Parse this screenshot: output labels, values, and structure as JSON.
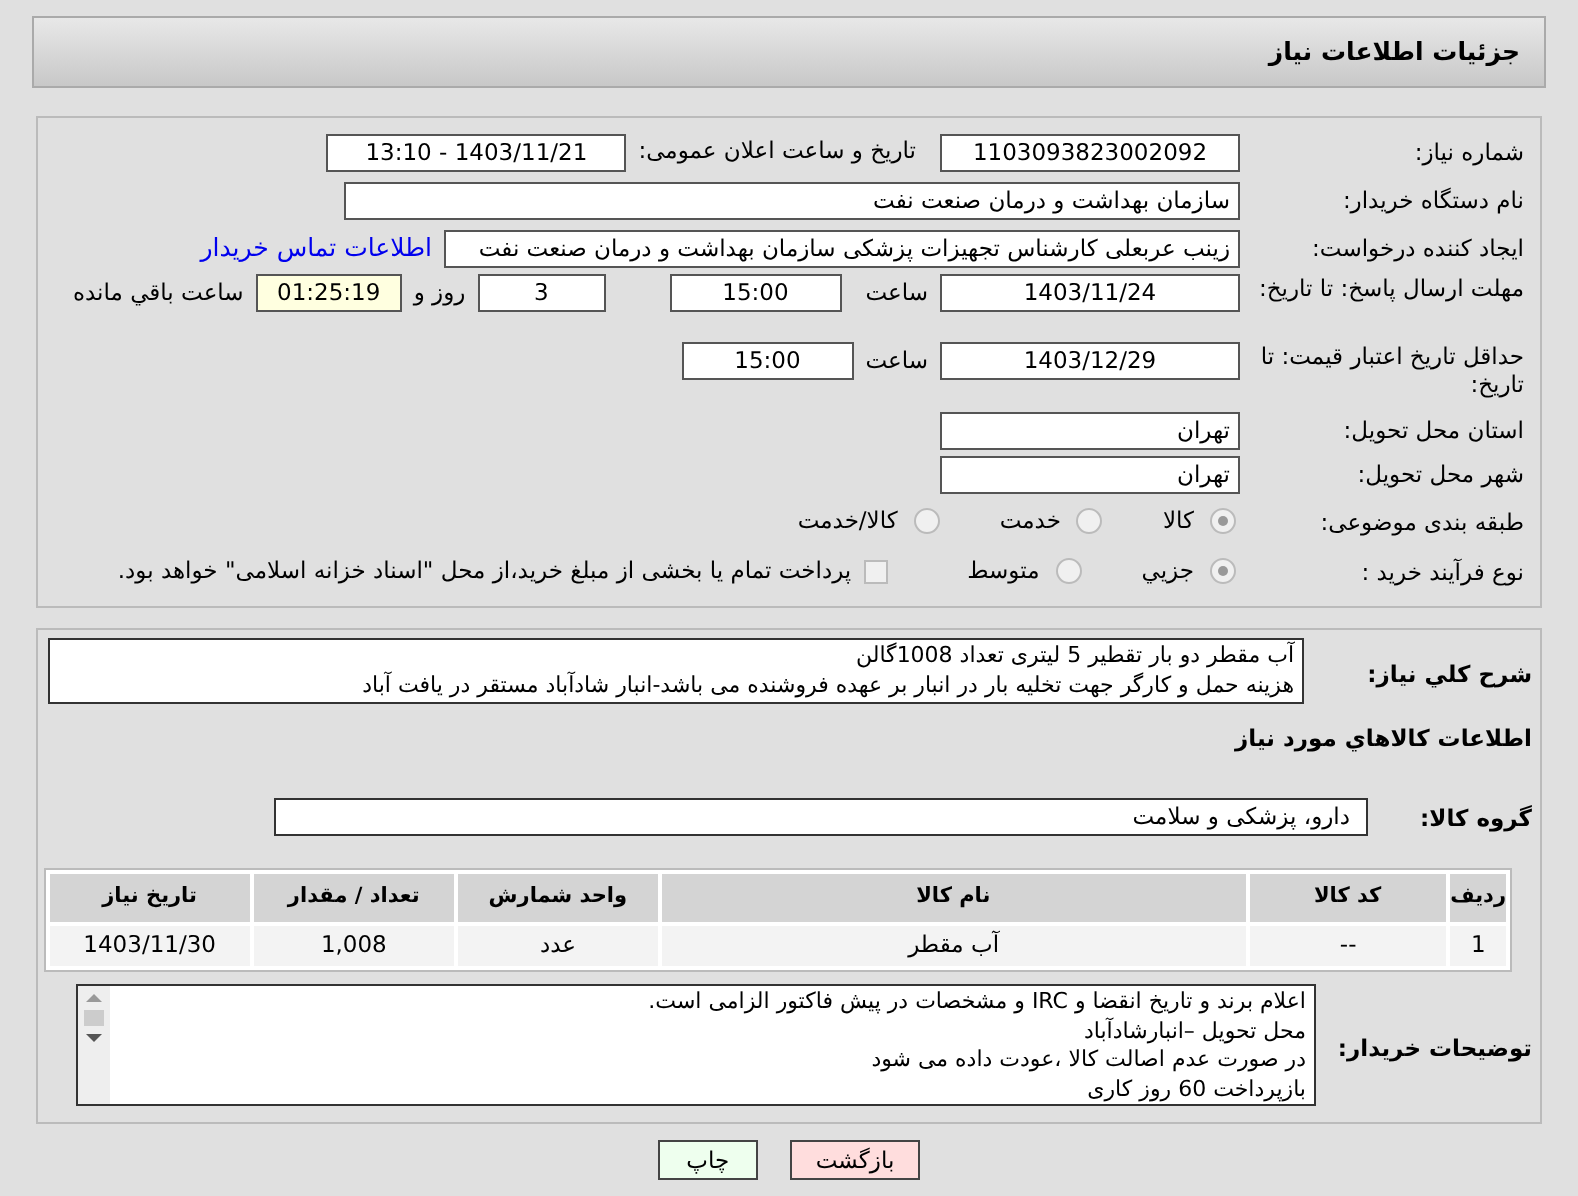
{
  "header": {
    "title": "جزئیات اطلاعات نیاز"
  },
  "need_number": {
    "label": "شماره نیاز:",
    "value": "1103093823002092"
  },
  "announce": {
    "label": "تاریخ و ساعت اعلان عمومی:",
    "value": "1403/11/21 - 13:10"
  },
  "buyer_org": {
    "label": "نام دستگاه خریدار:",
    "value": "سازمان بهداشت و درمان صنعت نفت"
  },
  "requester": {
    "label": "ایجاد کننده درخواست:",
    "value": "زینب عربعلی کارشناس تجهیزات پزشکی سازمان بهداشت و درمان صنعت نفت",
    "link": "اطلاعات تماس خریدار"
  },
  "reply_deadline": {
    "label": "مهلت ارسال پاسخ: تا تاریخ:",
    "date": "1403/11/24",
    "time_label": "ساعت",
    "time": "15:00",
    "days": "3",
    "days_label": "روز و",
    "remaining": "01:25:19",
    "remaining_label": "ساعت باقي مانده"
  },
  "price_validity": {
    "label": "حداقل تاریخ اعتبار قیمت: تا تاریخ:",
    "date": "1403/12/29",
    "time_label": "ساعت",
    "time": "15:00"
  },
  "province": {
    "label": "استان محل تحویل:",
    "value": "تهران"
  },
  "city": {
    "label": "شهر محل تحویل:",
    "value": "تهران"
  },
  "category": {
    "label": "طبقه بندی موضوعی:",
    "options": [
      {
        "label": "کالا",
        "selected": true
      },
      {
        "label": "خدمت",
        "selected": false
      },
      {
        "label": "کالا/خدمت",
        "selected": false
      }
    ]
  },
  "purchase_type": {
    "label": "نوع فرآیند خرید :",
    "options": [
      {
        "label": "جزیي",
        "selected": true
      },
      {
        "label": "متوسط",
        "selected": false
      }
    ],
    "checkbox": {
      "label": "پرداخت تمام یا بخشی از مبلغ خرید،از محل \"اسناد خزانه اسلامی\" خواهد بود.",
      "checked": false
    }
  },
  "description": {
    "label": "شرح کلي نياز:",
    "lines": [
      "آب مقطر دو بار تقطیر 5 لیتری  تعداد 1008گالن",
      "هزینه حمل و کارگر جهت تخلیه بار در انبار بر عهده فروشنده می باشد-انبار شادآباد مستقر در یافت آباد"
    ]
  },
  "goods_info_title": "اطلاعات کالاهاي مورد نياز",
  "goods_group": {
    "label": "گروه کالا:",
    "value": "دارو، پزشکی و سلامت"
  },
  "table": {
    "columns": [
      "ردیف",
      "کد کالا",
      "نام کالا",
      "واحد شمارش",
      "تعداد / مقدار",
      "تاریخ نیاز"
    ],
    "rows": [
      [
        "1",
        "--",
        "آب مقطر",
        "عدد",
        "1,008",
        "1403/11/30"
      ]
    ]
  },
  "buyer_notes": {
    "label": "توضیحات خریدار:",
    "lines": [
      "اعلام برند و تاریخ انقضا  و IRC  و مشخصات  در پیش فاکتور الزامی است.",
      "محل تحویل –انبارشادآباد",
      "در صورت عدم اصالت کالا ،عودت داده می شود",
      "بازپرداخت 60 روز کاری"
    ]
  },
  "buttons": [
    {
      "label": "بازگشت",
      "kind": "back"
    },
    {
      "label": "چاپ",
      "kind": "print"
    }
  ]
}
